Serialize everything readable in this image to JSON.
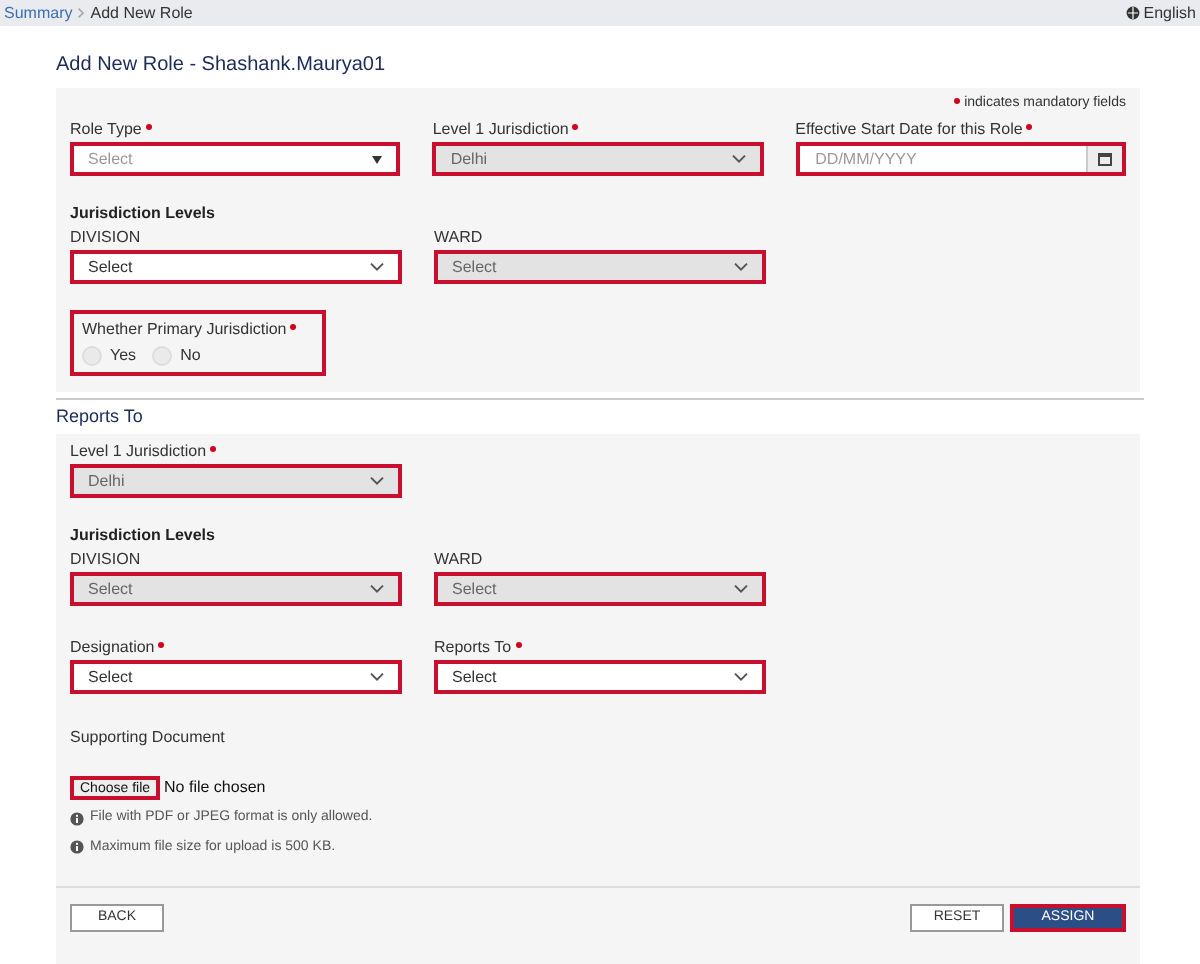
{
  "breadcrumb": [
    {
      "label": "Summary",
      "kind": "link"
    },
    {
      "label": "Add New Role",
      "kind": "current"
    }
  ],
  "language": "English",
  "title": "Add New Role - Shashank.Maurya01",
  "mandatory_note": "indicates mandatory fields",
  "role": {
    "fields": [
      {
        "label": "Role Type",
        "required": true,
        "kind": "dropdown",
        "placeholder": "Select",
        "disabled": false
      },
      {
        "label": "Level 1 Jurisdiction",
        "required": true,
        "kind": "select",
        "value": "Delhi",
        "disabled": true
      },
      {
        "label": "Effective Start Date for this Role",
        "required": true,
        "kind": "date",
        "placeholder": "DD/MM/YYYY",
        "disabled": false
      }
    ],
    "levels_heading": "Jurisdiction Levels",
    "levels": [
      {
        "label": "DIVISION",
        "required": false,
        "kind": "select",
        "value": "Select",
        "disabled": false
      },
      {
        "label": "WARD",
        "required": false,
        "kind": "select",
        "value": "Select",
        "disabled": true
      }
    ],
    "primary": {
      "label": "Whether Primary Jurisdiction",
      "required": true,
      "options": [
        {
          "label": "Yes",
          "selected": false
        },
        {
          "label": "No",
          "selected": false
        }
      ]
    }
  },
  "reports_to": {
    "title": "Reports To",
    "level1": {
      "label": "Level 1 Jurisdiction",
      "required": true,
      "kind": "select",
      "value": "Delhi",
      "disabled": true
    },
    "levels_heading": "Jurisdiction Levels",
    "levels": [
      {
        "label": "DIVISION",
        "required": false,
        "kind": "select",
        "value": "Select",
        "disabled": true
      },
      {
        "label": "WARD",
        "required": false,
        "kind": "select",
        "value": "Select",
        "disabled": true
      }
    ],
    "fields": [
      {
        "label": "Designation",
        "required": true,
        "kind": "select",
        "value": "Select",
        "disabled": false
      },
      {
        "label": "Reports To",
        "required": true,
        "kind": "select",
        "value": "Select",
        "disabled": false
      }
    ]
  },
  "document": {
    "label": "Supporting Document",
    "button": "Choose file",
    "status": "No file chosen",
    "notes": [
      "File with PDF or JPEG format is only allowed.",
      "Maximum file size for upload is 500 KB."
    ]
  },
  "buttons": [
    {
      "label": "BACK",
      "kind": "secondary"
    },
    {
      "label": "RESET",
      "kind": "secondary"
    },
    {
      "label": "ASSIGN",
      "kind": "primary"
    }
  ]
}
